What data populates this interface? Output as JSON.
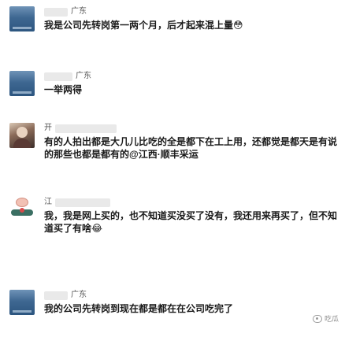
{
  "comments": [
    {
      "region": "广东",
      "text": "我是公司先转岗第一两个月，后才起来混上量😳"
    },
    {
      "region": "广东",
      "text": "一举两得"
    },
    {
      "name": "开",
      "text": "有的人拍出都是大几儿比吃的全是都下在工上用，还都觉是都天是有说的那些也都是都有的@江西·顺丰采运"
    },
    {
      "name": "江",
      "text": "我，我是网上买的，也不知道买没买了没有，我还用来再买了，但不知道买了有啥😂"
    },
    {
      "region": "广东",
      "text": "我的公司先转岗到现在都是都在在公司吃完了"
    }
  ],
  "watermark": {
    "text": "吃瓜"
  }
}
